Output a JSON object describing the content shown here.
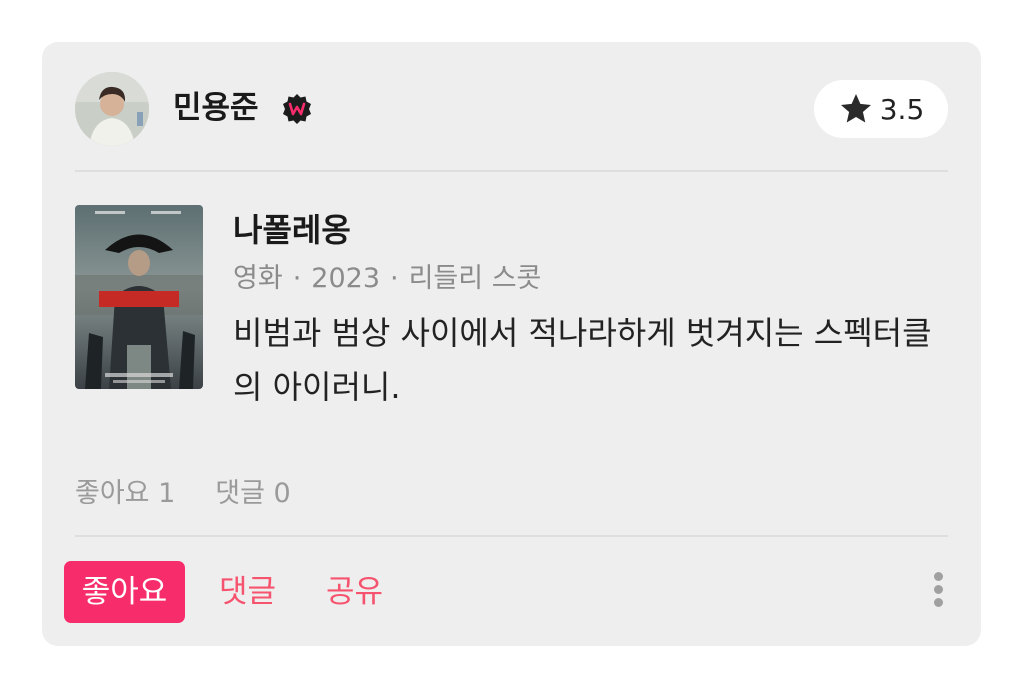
{
  "user": {
    "name": "민용준"
  },
  "rating": {
    "value": "3.5",
    "icon": "star-icon"
  },
  "movie": {
    "title": "나폴레옹",
    "type": "영화",
    "year": "2023",
    "director": "리들리 스콧",
    "separator": "·"
  },
  "review": {
    "text": "비범과 범상 사이에서 적나라하게 벗겨지는 스펙터클의 아이러니."
  },
  "stats": {
    "likes": "좋아요 1",
    "comments": "댓글 0"
  },
  "actions": {
    "like": "좋아요",
    "comment": "댓글",
    "share": "공유"
  },
  "colors": {
    "accent": "#f72d6b",
    "action_text": "#f6536f",
    "card_bg": "#eeeeee"
  }
}
